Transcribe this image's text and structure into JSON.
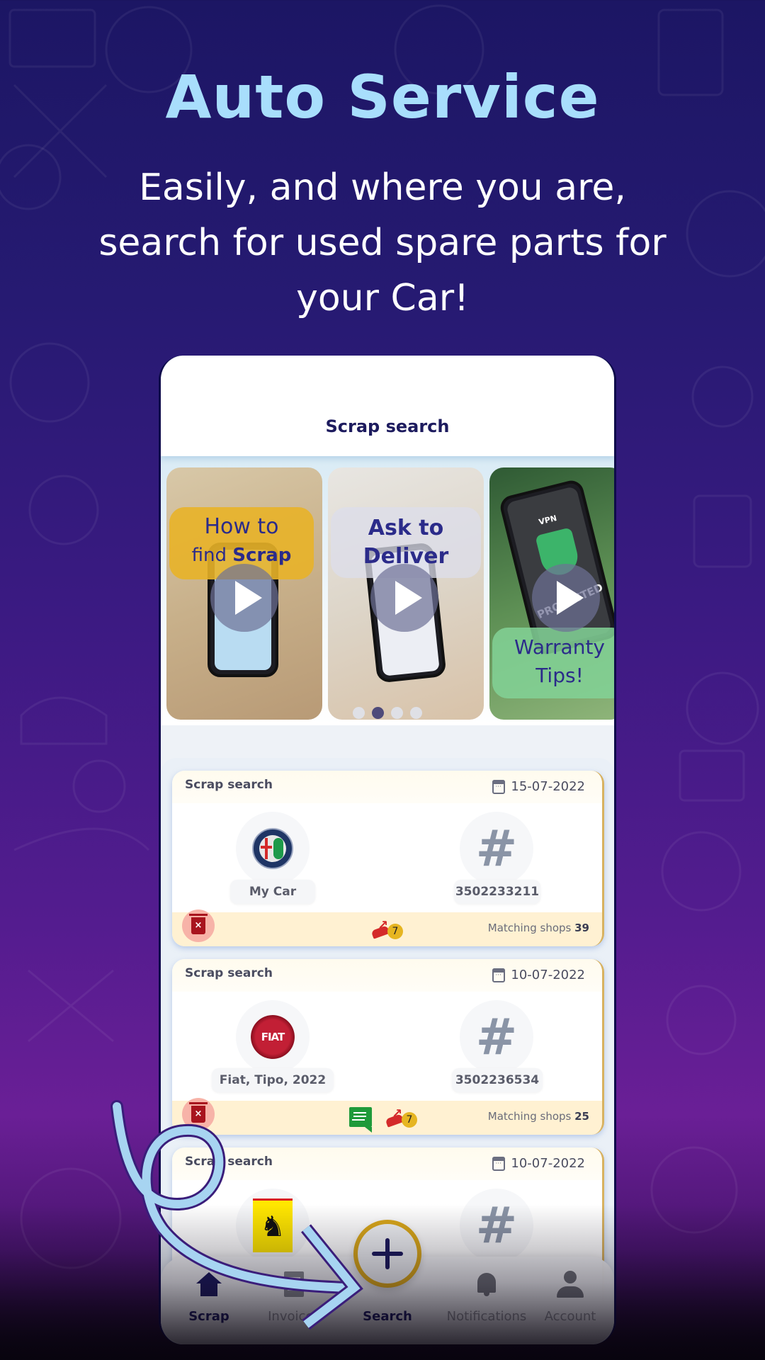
{
  "hero": {
    "title": "Auto Service",
    "subtitle_lines": [
      "Easily, and where you are,",
      "search for used spare parts for",
      "your Car!"
    ]
  },
  "app": {
    "header_title": "Scrap search",
    "carousel": {
      "slides": [
        {
          "label_line1": "How to",
          "label_line2_pre": "find ",
          "label_line2_bold": "Scrap",
          "icon": "play-icon"
        },
        {
          "label_line1": "Ask to",
          "label_line2": "Deliver",
          "icon": "play-icon"
        },
        {
          "label_line1": "Warranty",
          "label_line2": "Tips!",
          "image_text_1": "VPN",
          "image_text_2": "PROTECTED",
          "icon": "play-icon"
        }
      ],
      "page_count": 4,
      "active_page": 2
    },
    "searches": [
      {
        "kind": "Scrap search",
        "date": "15-07-2022",
        "vehicle_label": "My Car",
        "brand_icon": "alfa-romeo-logo",
        "part_number": "3502233211",
        "has_message": false,
        "missed_calls": "7",
        "matching_label": "Matching shops",
        "matching_count": "39"
      },
      {
        "kind": "Scrap search",
        "date": "10-07-2022",
        "vehicle_label": "Fiat, Tipo, 2022",
        "brand_icon": "fiat-logo",
        "brand_text": "FIAT",
        "part_number": "3502236534",
        "has_message": true,
        "missed_calls": "7",
        "matching_label": "Matching shops",
        "matching_count": "25"
      },
      {
        "kind": "Scrap search",
        "date": "10-07-2022",
        "brand_icon": "ferrari-logo"
      }
    ],
    "hash_symbol": "#",
    "nav": {
      "items": [
        {
          "label": "Scrap",
          "icon": "home-icon",
          "active": true
        },
        {
          "label": "Invoices",
          "icon": "invoice-icon",
          "active": false
        },
        {
          "label": "Search",
          "icon": "plus-icon",
          "active": true
        },
        {
          "label": "Notifications",
          "icon": "bell-icon",
          "active": false
        },
        {
          "label": "Account",
          "icon": "user-icon",
          "active": false
        }
      ]
    }
  },
  "colors": {
    "title": "#a8defc",
    "brand_dark": "#1d1b5e",
    "fab_ring": "#d9a71a",
    "delete": "#a8141e",
    "card_footer": "#fff1d2"
  }
}
